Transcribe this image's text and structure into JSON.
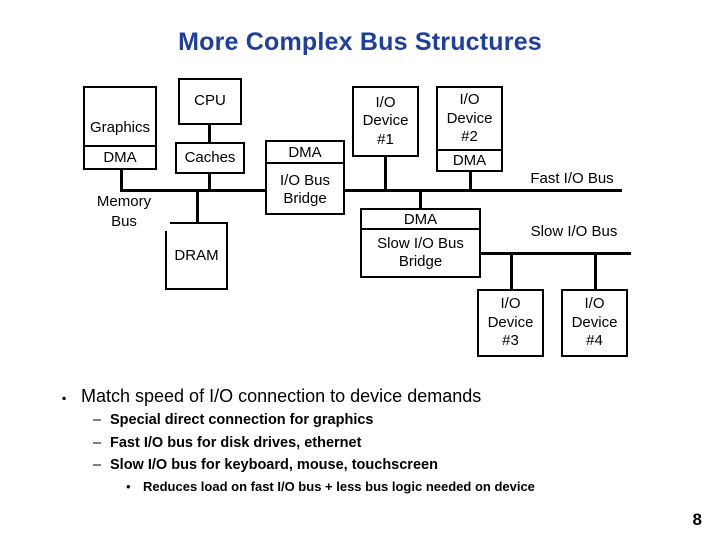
{
  "slide": {
    "title": "More Complex Bus Structures",
    "page_number": "8",
    "title_color": "#1f3fa0",
    "line_color": "#000000",
    "background": "#ffffff"
  },
  "diagram": {
    "graphics_box": {
      "label": "Graphics",
      "sub_label": "DMA"
    },
    "cpu_box": {
      "label": "CPU"
    },
    "caches_box": {
      "label": "Caches"
    },
    "dram_box": {
      "label": "DRAM"
    },
    "io_bus_bridge": {
      "sub_label": "DMA",
      "line1": "I/O Bus",
      "line2": "Bridge"
    },
    "io_device_1": {
      "line1": "I/O",
      "line2": "Device",
      "line3": "#1"
    },
    "io_device_2": {
      "line1": "I/O",
      "line2": "Device",
      "line3": "#2",
      "sub_label": "DMA"
    },
    "slow_bus_bridge": {
      "sub_label": "DMA",
      "line1": "Slow I/O Bus",
      "line2": "Bridge"
    },
    "io_device_3": {
      "line1": "I/O",
      "line2": "Device",
      "line3": "#3"
    },
    "io_device_4": {
      "line1": "I/O",
      "line2": "Device",
      "line3": "#4"
    },
    "bus_labels": {
      "memory_bus_line1": "Memory",
      "memory_bus_line2": "Bus",
      "fast_io_bus": "Fast I/O Bus",
      "slow_io_bus": "Slow I/O Bus"
    }
  },
  "bullets": {
    "level1_marker": "▪",
    "level2_marker": "–",
    "level3_marker": "•",
    "items": [
      {
        "level": 1,
        "text": "Match speed of I/O connection to device demands"
      },
      {
        "level": 2,
        "text": "Special direct connection for graphics"
      },
      {
        "level": 2,
        "text": "Fast I/O bus for disk drives, ethernet"
      },
      {
        "level": 2,
        "text": "Slow I/O bus for keyboard, mouse, touchscreen"
      },
      {
        "level": 3,
        "text": "Reduces load on fast I/O bus + less bus logic needed on device"
      }
    ]
  }
}
